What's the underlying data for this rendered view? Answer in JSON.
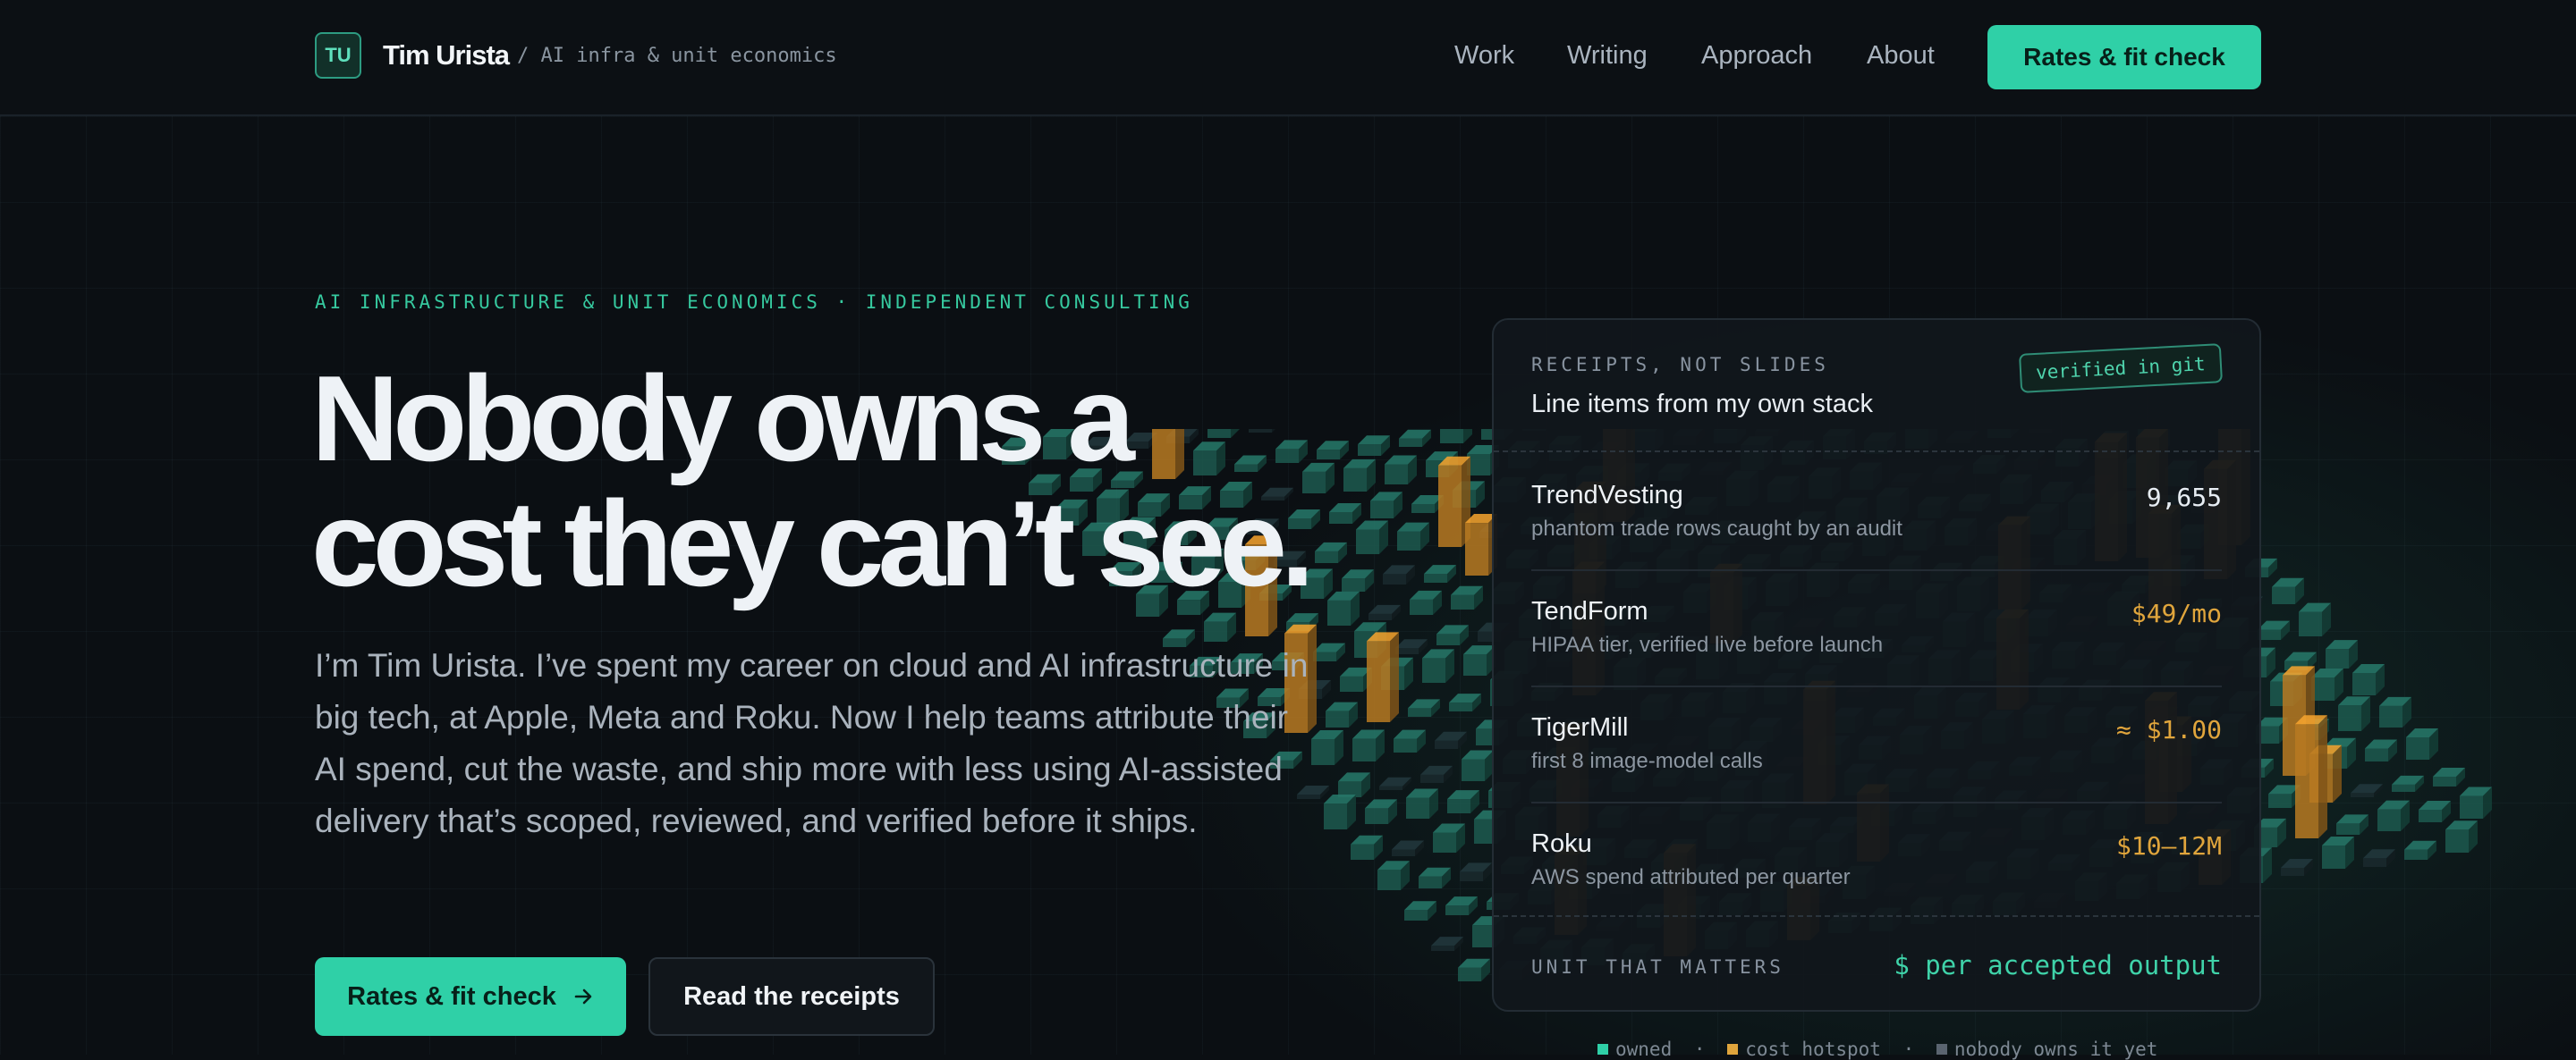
{
  "nav": {
    "logo_initials": "TU",
    "name": "Tim Urista",
    "tagline": "/ AI infra & unit economics",
    "links": [
      "Work",
      "Writing",
      "Approach",
      "About"
    ],
    "cta": "Rates & fit check"
  },
  "hero": {
    "eyebrow": "AI INFRASTRUCTURE & UNIT ECONOMICS · INDEPENDENT CONSULTING",
    "headline_line1": "Nobody owns a",
    "headline_line2": "cost they can’t see.",
    "lead": "I’m Tim Urista. I’ve spent my career on cloud and AI infrastructure in big tech, at Apple, Meta and Roku. Now I help teams attribute their AI spend, cut the waste, and ship more with less using AI-assisted delivery that’s scoped, reviewed, and verified before it ships.",
    "primary_button": "Rates & fit check",
    "primary_button_icon": "arrow-right-icon",
    "secondary_button": "Read the receipts"
  },
  "receipts": {
    "eyebrow": "RECEIPTS, NOT SLIDES",
    "title": "Line items from my own stack",
    "stamp": "verified in git",
    "items": [
      {
        "name": "TrendVesting",
        "desc": "phantom trade rows caught by an audit",
        "value": "9,655",
        "color": "#e7edf3"
      },
      {
        "name": "TendForm",
        "desc": "HIPAA tier, verified live before launch",
        "value": "$49/mo",
        "color": "#e0a53c"
      },
      {
        "name": "TigerMill",
        "desc": "first 8 image-model calls",
        "value": "≈ $1.00",
        "color": "#e0a53c"
      },
      {
        "name": "Roku",
        "desc": "AWS spend attributed per quarter",
        "value": "$10–12M",
        "color": "#e0a53c"
      }
    ],
    "footer_label": "UNIT THAT MATTERS",
    "footer_value": "$ per accepted output"
  },
  "legend": {
    "items": [
      {
        "label": "owned",
        "color": "#2fd0a7"
      },
      {
        "label": "cost hotspot",
        "color": "#e0a53c"
      },
      {
        "label": "nobody owns it yet",
        "color": "#5a6470"
      }
    ],
    "separator": "·"
  },
  "colors": {
    "accent": "#2fd0a7",
    "amber": "#e0a53c",
    "background": "#0b0f13"
  }
}
